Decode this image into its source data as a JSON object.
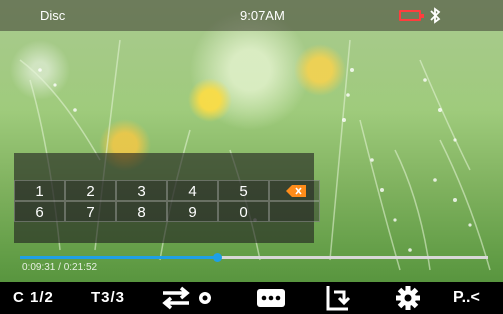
{
  "statusbar": {
    "source": "Disc",
    "time": "9:07AM",
    "battery_icon": "battery-low-icon",
    "bluetooth_icon": "bluetooth-icon",
    "battery_color": "#ff3d3d"
  },
  "keypad": {
    "keys": [
      {
        "label": "1"
      },
      {
        "label": "2"
      },
      {
        "label": "3"
      },
      {
        "label": "4"
      },
      {
        "label": "5"
      },
      {
        "label": "6"
      },
      {
        "label": "7"
      },
      {
        "label": "8"
      },
      {
        "label": "9"
      },
      {
        "label": "0"
      }
    ],
    "backspace_icon": "backspace-icon",
    "accent_color": "#ff8c1a"
  },
  "playback": {
    "progress_fraction": 0.42,
    "time_readout": "0:09:31 / 0:21:52",
    "progress_color": "#1ea0e6"
  },
  "toolbar": {
    "chapter": "C 1/2",
    "track": "T3/3",
    "repeat_icon": "repeat-icon",
    "more_icon": "more-icon",
    "rotate_icon": "rotate-icon",
    "settings_icon": "gear-icon",
    "pip_label": "P..<"
  }
}
